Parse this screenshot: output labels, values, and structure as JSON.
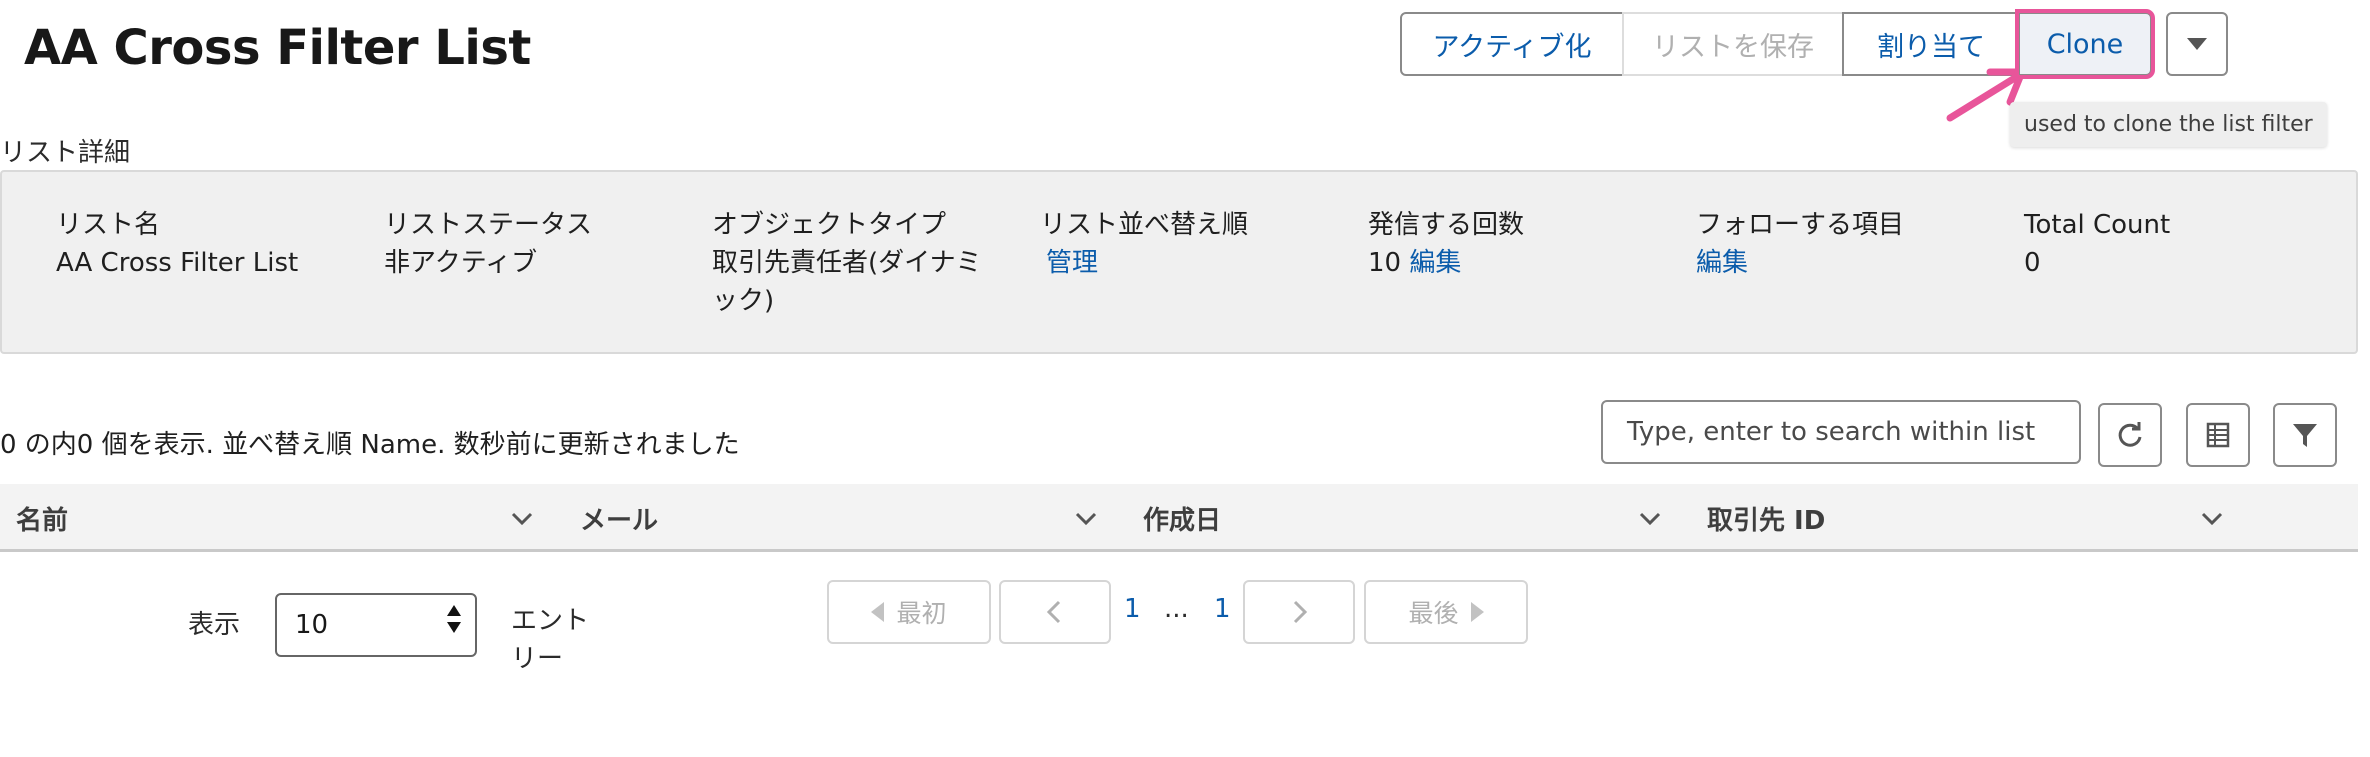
{
  "page": {
    "title": "AA Cross Filter List"
  },
  "actions": {
    "activate": "アクティブ化",
    "save_list": "リストを保存",
    "assign": "割り当て",
    "clone": "Clone",
    "more_icon": "chevron-down-icon"
  },
  "tooltip": {
    "text": "used to clone the list filter"
  },
  "details": {
    "section_label": "リスト詳細",
    "list_name_label": "リスト名",
    "list_name_value": "AA Cross Filter List",
    "status_label": "リストステータス",
    "status_value": "非アクティブ",
    "object_type_label": "オブジェクトタイプ",
    "object_type_line1": "取引先責任者(ダイナミ",
    "object_type_line2": "ック)",
    "sort_order_label": "リスト並べ替え順",
    "sort_order_link": "管理",
    "call_count_label": "発信する回数",
    "call_count_value": "10",
    "call_count_link": "編集",
    "follow_label": "フォローする項目",
    "follow_link": "編集",
    "total_label": "Total Count",
    "total_value": "0"
  },
  "list_view": {
    "summary": "0 の内0 個を表示. 並べ替え順 Name. 数秒前に更新されました",
    "search_placeholder": "Type, enter to search within list",
    "icons": [
      "refresh-icon",
      "table-settings-icon",
      "filter-icon"
    ]
  },
  "table": {
    "columns": [
      "名前",
      "メール",
      "作成日",
      "取引先 ID"
    ],
    "rows": []
  },
  "pagination": {
    "show_label": "表示",
    "page_size": "10",
    "entries_label_line1": "エント",
    "entries_label_line2": "リー",
    "first": "最初",
    "last": "最後",
    "current_page": "1",
    "ellipsis": "...",
    "last_page": "1"
  },
  "colors": {
    "link": "#0b5cab",
    "highlight": "#e8559a",
    "panel_bg": "#f0f0f0"
  }
}
